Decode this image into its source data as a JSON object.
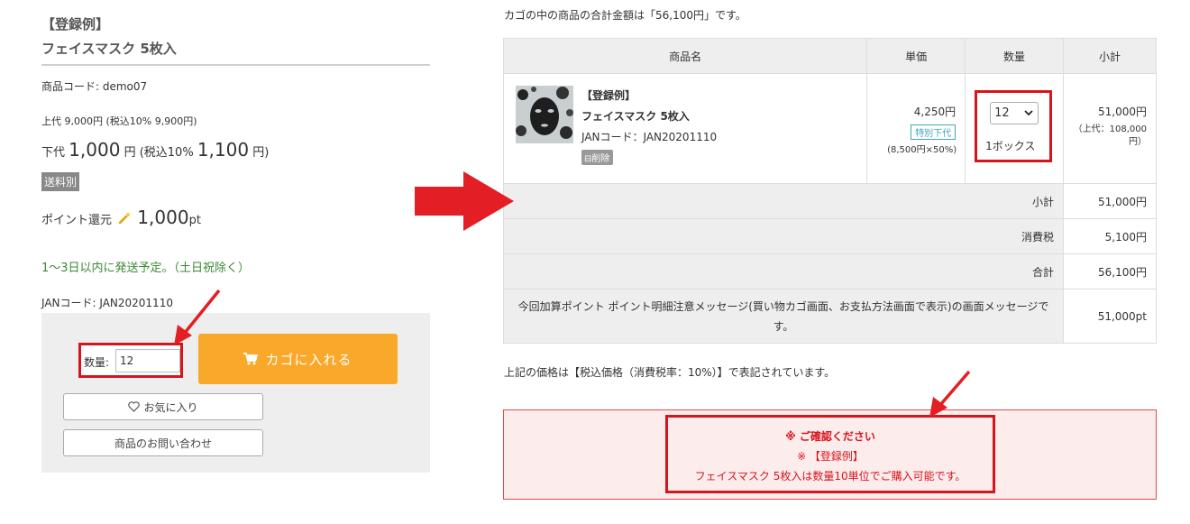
{
  "product": {
    "title_prefix": "【登録例】",
    "title": "フェイスマスク 5枚入",
    "code": "商品コード: demo07",
    "list_price": "上代 9,000円 (税込10% 9,900円)",
    "sale_label": "下代",
    "sale_price": "1,000",
    "sale_unit": "円",
    "sale_tax_label": "(税込10%",
    "sale_tax_price": "1,100",
    "sale_tax_unit": "円)",
    "shipping_badge": "送料別",
    "point_label": "ポイント還元",
    "point_value": "1,000",
    "point_unit": "pt",
    "delivery": "1〜3日以内に発送予定。（土日祝除く）",
    "jan": "JANコード: JAN20201110",
    "qty_label": "数量:",
    "qty_value": "12",
    "cart_button": "カゴに入れる",
    "favorite_button": "お気に入り",
    "inquiry_button": "商品のお問い合わせ"
  },
  "cart": {
    "total_message": "カゴの中の商品の合計金額は「56,100円」です。",
    "headers": [
      "商品名",
      "単価",
      "数量",
      "小計"
    ],
    "item": {
      "title_prefix": "【登録例】",
      "title": "フェイスマスク 5枚入",
      "jan": "JANコード：JAN20201110",
      "delete": "削除",
      "unit_price": "4,250円",
      "unit_badge": "特別下代",
      "unit_calc": "(8,500円×50%)",
      "qty": "12",
      "qty_unit": "1ボックス",
      "subtotal": "51,000円",
      "subtotal_list": "（上代：108,000円）"
    },
    "summary": [
      {
        "label": "小計",
        "value": "51,000円"
      },
      {
        "label": "消費税",
        "value": "5,100円"
      },
      {
        "label": "合計",
        "value": "56,100円"
      }
    ],
    "point_label": "今回加算ポイント ポイント明細注意メッセージ(買い物カゴ画面、お支払方法画面で表示)の画面メッセージです。",
    "point_value": "51,000pt",
    "tax_note": "上記の価格は【税込価格（消費税率：10%）】で表記されています。",
    "alert": {
      "title": "※ ご確認ください",
      "line2": "※ 【登録例】",
      "line3": "フェイスマスク 5枚入は数量10単位でご購入可能です。"
    }
  },
  "colors": {
    "accent_red": "#d6141b",
    "cart_button": "#f9a829",
    "delivery_green": "#3b8a32",
    "badge_teal": "#40a6b8"
  }
}
